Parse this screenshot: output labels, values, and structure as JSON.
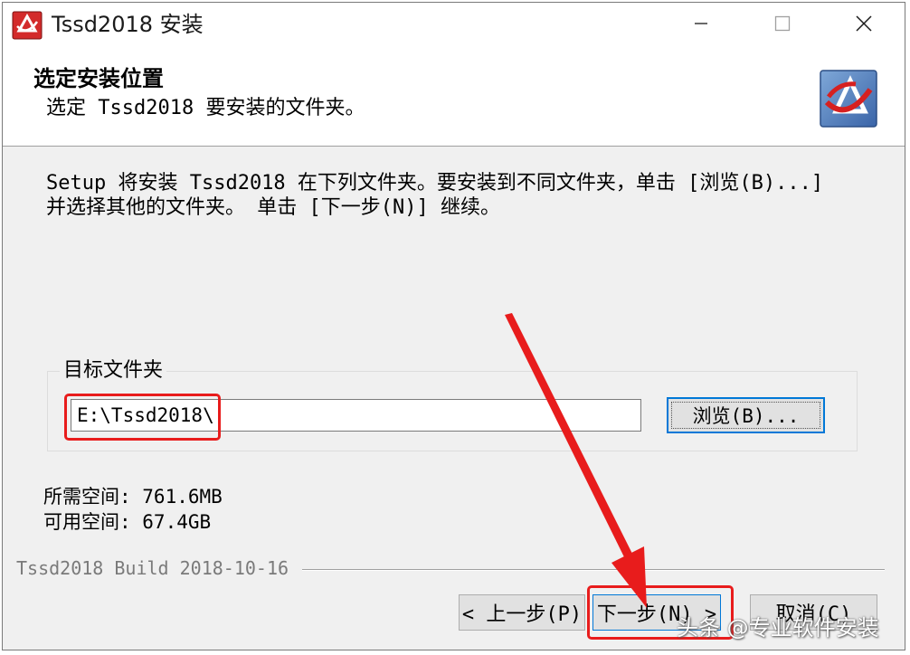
{
  "window": {
    "title": "Tssd2018 安装"
  },
  "header": {
    "title": "选定安装位置",
    "subtitle": "选定 Tssd2018 要安装的文件夹。"
  },
  "intro": {
    "line1": "Setup 将安装 Tssd2018 在下列文件夹。要安装到不同文件夹，单击 [浏览(B)...]",
    "line2": "并选择其他的文件夹。 单击 [下一步(N)] 继续。"
  },
  "destination": {
    "group_label": "目标文件夹",
    "path_value": "E:\\Tssd2018\\",
    "browse_label": "浏览(B)..."
  },
  "space": {
    "required": "所需空间: 761.6MB",
    "available": "可用空间: 67.4GB"
  },
  "footer": {
    "build": "Tssd2018 Build 2018-10-16",
    "back_label": "< 上一步(P)",
    "next_label": "下一步(N) >",
    "cancel_label": "取消(C)"
  },
  "annotations": {
    "highlight_color": "#e81c1c"
  },
  "watermark": {
    "text": "头条 @专业软件安装"
  },
  "colors": {
    "accent": "#0078d7",
    "window_bg": "#f0f0f0",
    "header_bg": "#ffffff"
  },
  "icons": {
    "app": "tssd-logo-icon",
    "header": "tssd-logo-icon",
    "minimize": "minimize-icon",
    "maximize": "maximize-icon",
    "close": "close-icon"
  }
}
